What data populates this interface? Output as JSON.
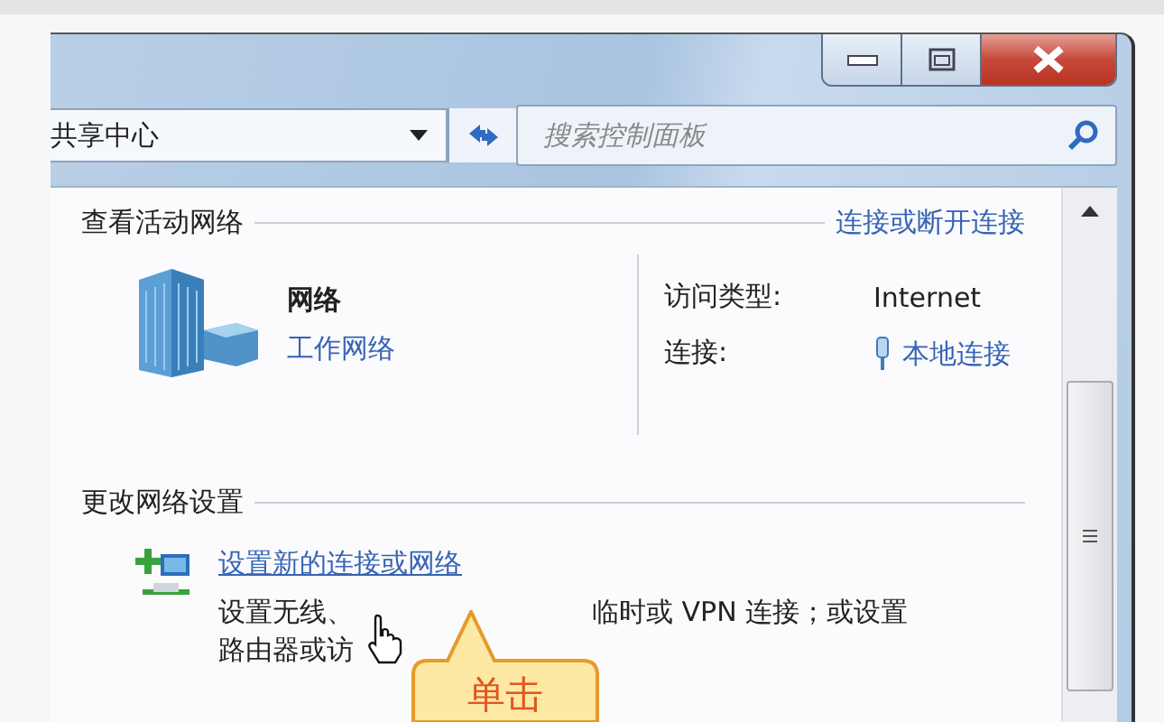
{
  "address_bar": {
    "path": "共享中心"
  },
  "search": {
    "placeholder": "搜索控制面板"
  },
  "active_networks": {
    "heading": "查看活动网络",
    "link": "连接或断开连接",
    "network": {
      "name": "网络",
      "type": "工作网络"
    },
    "details": [
      {
        "label": "访问类型:",
        "value": "Internet",
        "kind": "text"
      },
      {
        "label": "连接:",
        "value": "本地连接",
        "kind": "link"
      }
    ]
  },
  "change_settings": {
    "heading": "更改网络设置",
    "tasks": [
      {
        "link": "设置新的连接或网络",
        "description_visible": [
          "设置无线、",
          "临时或 VPN 连接；或设置"
        ],
        "description_line2": "路由器或访"
      }
    ]
  },
  "callout": {
    "text": "单击"
  }
}
